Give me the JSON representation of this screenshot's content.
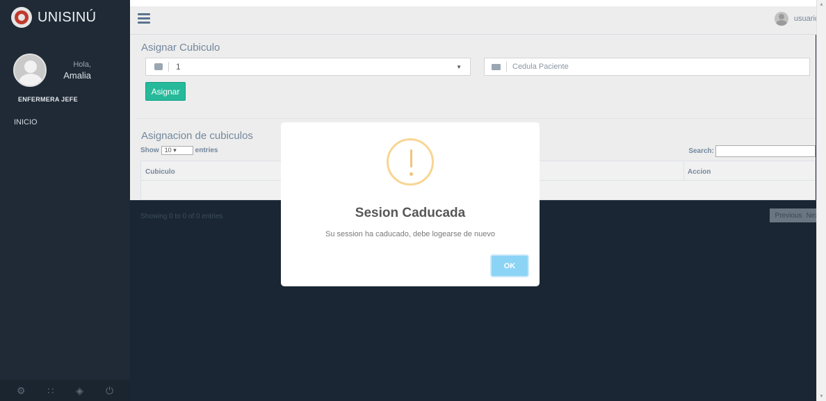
{
  "brand": {
    "name": "UNISINÚ"
  },
  "profile": {
    "greeting": "Hola,",
    "name": "Amalia",
    "role": "ENFERMERA JEFE"
  },
  "menu": {
    "inicio": "INICIO"
  },
  "sidebar_footer": {
    "icons": [
      "gear-icon",
      "fullscreen-icon",
      "eye-slash-icon",
      "power-icon"
    ]
  },
  "topbar": {
    "user_label": "usuario"
  },
  "assign_form": {
    "title": "Asignar Cubiculo",
    "cubicle_value": "1",
    "patient_placeholder": "Cedula Paciente",
    "submit_label": "Asignar"
  },
  "table_section": {
    "title": "Asignacion de cubiculos",
    "show_label": "Show",
    "page_size": "10",
    "entries_label": "entries",
    "search_label": "Search:",
    "columns": [
      "Cubiculo",
      "Accion"
    ],
    "info": "Showing 0 to 0 of 0 entries",
    "prev_label": "Previous",
    "next_label": "Next"
  },
  "modal": {
    "title": "Sesion Caducada",
    "message": "Su session ha caducado, debe logearse de nuevo",
    "ok_label": "OK"
  },
  "colors": {
    "sidebar": "#1f2a36",
    "primary_button": "#26b99a",
    "ok_button": "#8cd4f5",
    "warning": "#f8d592"
  }
}
